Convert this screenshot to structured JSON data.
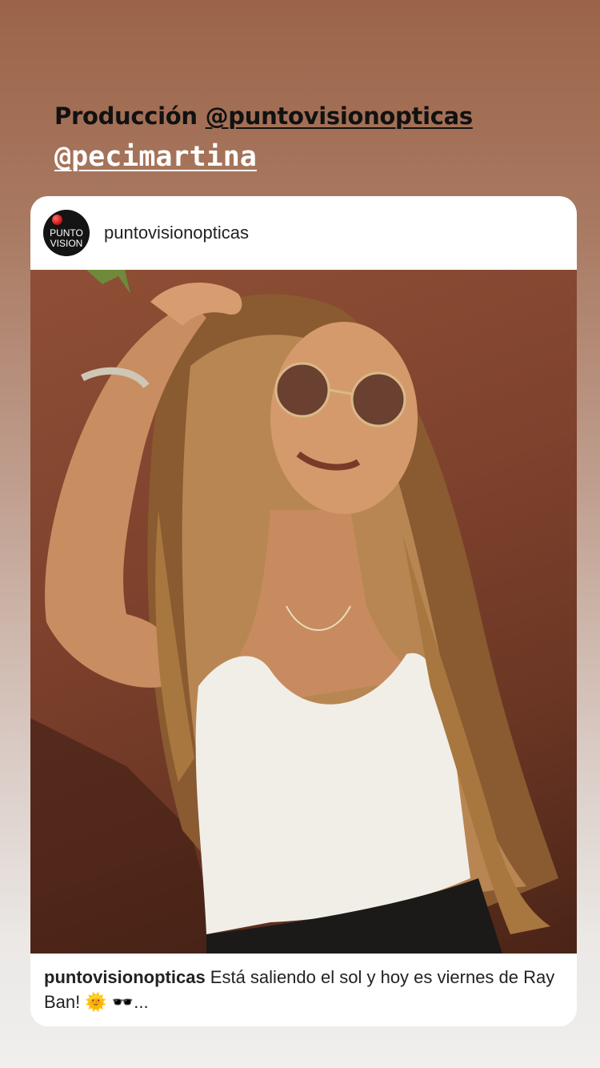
{
  "story": {
    "line1_prefix": "Producción ",
    "line1_mention": "@puntovisionopticas",
    "line2_mention": "@pecimartina"
  },
  "post": {
    "avatar_line1": "PUNTO",
    "avatar_line2": "VISION",
    "username": "puntovisionopticas",
    "caption_user": "puntovisionopticas",
    "caption_text": " Está saliendo el sol y hoy es viernes de Ray Ban! 🌞 🕶️...",
    "photo_subject": "woman-with-sunglasses-photo"
  },
  "colors": {
    "accent_red": "#d11b1b",
    "background_top": "#9b6449",
    "background_bottom": "#f0efee"
  }
}
